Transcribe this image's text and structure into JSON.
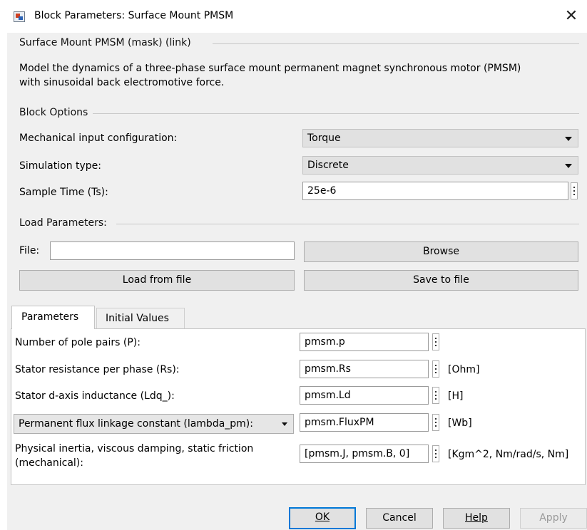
{
  "window": {
    "title": "Block Parameters: Surface Mount PMSM",
    "close_glyph": "✕"
  },
  "header": {
    "legend": "Surface Mount PMSM (mask) (link)",
    "description_line1": "Model the dynamics of a three-phase surface mount permanent magnet synchronous motor (PMSM)",
    "description_line2": "with sinusoidal back electromotive force."
  },
  "block_options": {
    "legend": "Block Options",
    "mechanical_input": {
      "label": "Mechanical input configuration:",
      "value": "Torque"
    },
    "simulation_type": {
      "label": "Simulation type:",
      "value": "Discrete"
    },
    "sample_time": {
      "label": "Sample Time (Ts):",
      "value": "25e-6"
    }
  },
  "load_parameters": {
    "legend": "Load Parameters:",
    "file_label": "File:",
    "file_value": "",
    "browse_label": "Browse",
    "load_label": "Load from file",
    "save_label": "Save to file"
  },
  "tabs": [
    {
      "label": "Parameters",
      "active": true
    },
    {
      "label": "Initial Values",
      "active": false
    }
  ],
  "parameters": [
    {
      "label": "Number of pole pairs (P):",
      "value": "pmsm.p",
      "unit": ""
    },
    {
      "label": "Stator resistance per phase (Rs):",
      "value": "pmsm.Rs",
      "unit": "[Ohm]"
    },
    {
      "label": "Stator d-axis inductance (Ldq_):",
      "value": "pmsm.Ld",
      "unit": "[H]"
    },
    {
      "label": "Permanent flux linkage constant (lambda_pm):",
      "value": "pmsm.FluxPM",
      "unit": "[Wb]"
    },
    {
      "label_line1": "Physical inertia, viscous damping, static friction",
      "label_line2": "(mechanical):",
      "value": "[pmsm.J, pmsm.B, 0]",
      "unit": "[Kgm^2, Nm/rad/s, Nm]"
    }
  ],
  "footer": {
    "ok": "OK",
    "cancel": "Cancel",
    "help": "Help",
    "apply": "Apply"
  },
  "icons": {
    "app": "simulink-block-icon",
    "close": "close-icon",
    "dropdown": "chevron-down-icon",
    "more": "vertical-ellipsis-icon"
  },
  "colors": {
    "dialog_bg": "#f0f0f0",
    "button_bg": "#e1e1e1",
    "ok_border": "#0078d7",
    "disabled_text": "#9a9a9a"
  }
}
